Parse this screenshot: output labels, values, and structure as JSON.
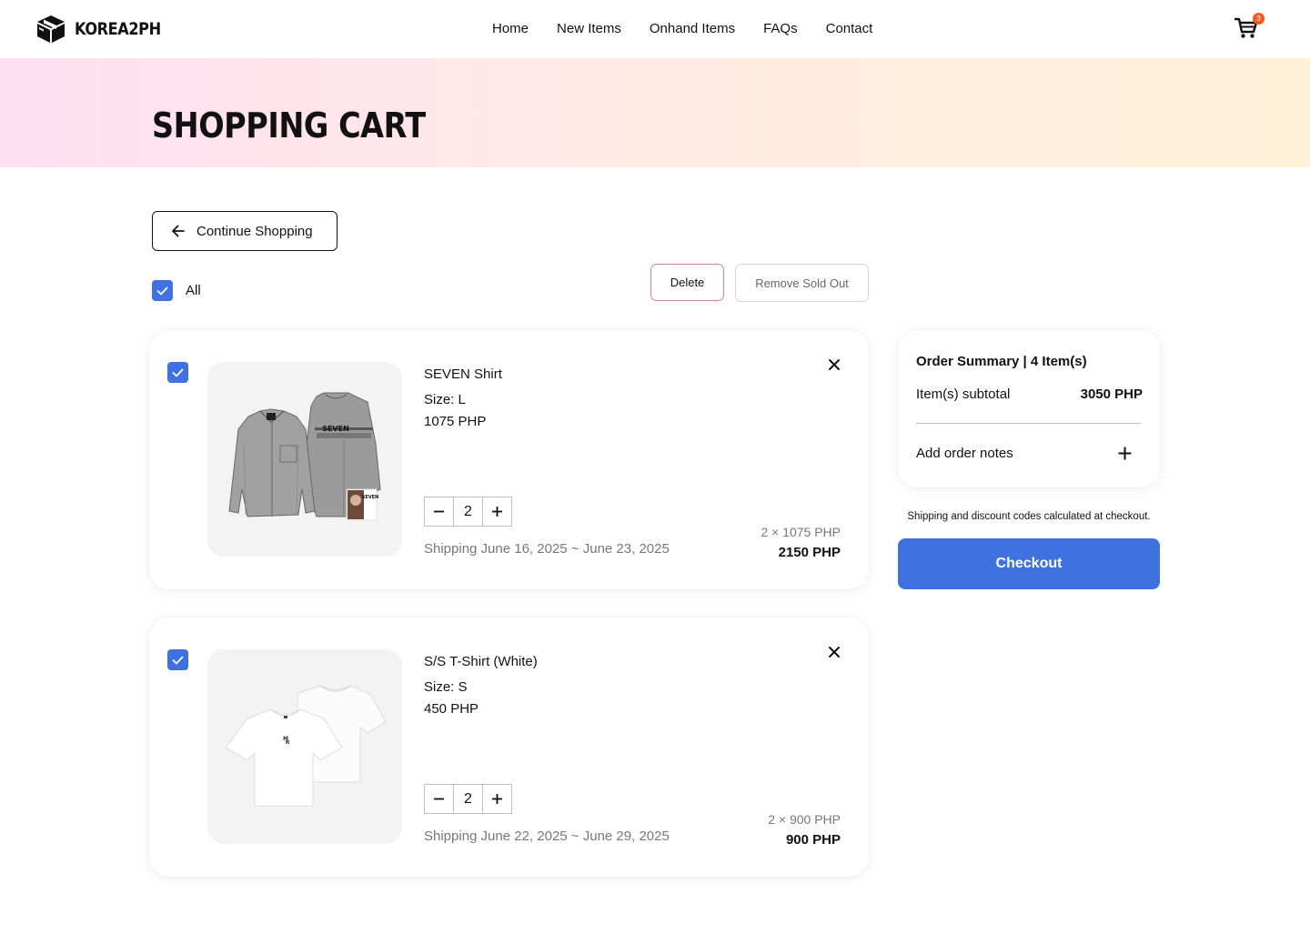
{
  "header": {
    "brand": "KOREA2PH",
    "nav": [
      "Home",
      "New Items",
      "Onhand Items",
      "FAQs",
      "Contact"
    ],
    "cart_count": "3"
  },
  "hero": {
    "title": "SHOPPING CART"
  },
  "actions": {
    "continue_label": "Continue Shopping",
    "select_all_label": "All",
    "delete_label": "Delete",
    "remove_sold_out_label": "Remove Sold Out"
  },
  "items": [
    {
      "name": "SEVEN Shirt",
      "size": "Size: L",
      "price": "1075 PHP",
      "quantity": "2",
      "shipping": "Shipping June 16, 2025 ~ June 23, 2025",
      "calc": "2 × 1075 PHP",
      "total": "2150 PHP",
      "checked": true
    },
    {
      "name": "S/S T-Shirt (White)",
      "size": "Size: S",
      "price": "450 PHP",
      "quantity": "2",
      "shipping": "Shipping June 22, 2025 ~ June 29, 2025",
      "calc": "2 × 900 PHP",
      "total": "900 PHP",
      "checked": true
    }
  ],
  "summary": {
    "title": "Order Summary | 4 Item(s)",
    "subtotal_label": "Item(s) subtotal",
    "subtotal_value": "3050 PHP",
    "notes_label": "Add order notes",
    "shipping_note": "Shipping and discount codes calculated at checkout.",
    "checkout_label": "Checkout"
  },
  "colors": {
    "accent": "#3f72e0",
    "badge": "#f15a24",
    "delete_border": "#d9847f"
  },
  "icons": [
    "logo-box-icon",
    "cart-icon",
    "arrow-left-icon",
    "check-icon",
    "close-icon",
    "minus-icon",
    "plus-icon"
  ]
}
